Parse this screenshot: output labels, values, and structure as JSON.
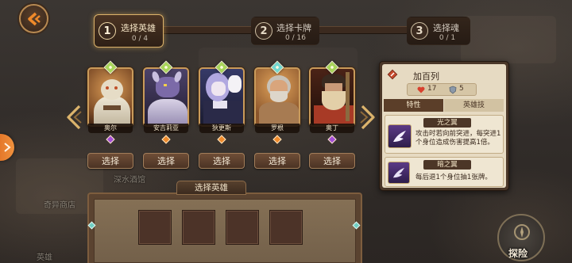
{
  "back_button": {
    "icon": "back-arrow-icon"
  },
  "steps": [
    {
      "number": "1",
      "label": "选择英雄",
      "progress": "0 / 4",
      "active": true
    },
    {
      "number": "2",
      "label": "选择卡牌",
      "progress": "0 / 16",
      "active": false
    },
    {
      "number": "3",
      "label": "选择魂",
      "progress": "0 / 1",
      "active": false
    }
  ],
  "hero_carousel": {
    "prev_icon": "chevron-left-icon",
    "next_icon": "chevron-right-icon"
  },
  "heroes": [
    {
      "name": "奥尔",
      "select_label": "选择",
      "rank_color": "#a8d65a",
      "tier_color": "#a44fd6"
    },
    {
      "name": "安吉莉亚",
      "select_label": "选择",
      "rank_color": "#a8d65a",
      "tier_color": "#ee8a2c"
    },
    {
      "name": "狄更斯",
      "select_label": "选择",
      "rank_color": "#a8d65a",
      "tier_color": "#ee8a2c"
    },
    {
      "name": "罗根",
      "select_label": "选择",
      "rank_color": "#72d8d0",
      "tier_color": "#ee8a2c"
    },
    {
      "name": "奥丁",
      "select_label": "选择",
      "rank_color": "#a8d65a",
      "tier_color": "#a44fd6"
    }
  ],
  "hero_detail": {
    "name": "加百列",
    "stats": [
      {
        "icon": "heart-icon",
        "value": "17"
      },
      {
        "icon": "shield-icon",
        "value": "5"
      }
    ],
    "tabs": [
      {
        "label": "特性",
        "active": true
      },
      {
        "label": "英雄技",
        "active": false
      }
    ],
    "traits": [
      {
        "title": "光之翼",
        "description": "攻击时若向前突进，每突进1个身位造成伤害提高1倍。",
        "icon": "light-wing-icon"
      },
      {
        "title": "暗之翼",
        "description": "每后退1个身位抽1张牌。",
        "icon": "dark-wing-icon"
      }
    ]
  },
  "selection_tray": {
    "title": "选择英雄"
  },
  "background": {
    "tavern_label": "深水酒馆",
    "shop_label": "奇异商店",
    "heroes_label": "英雄",
    "explore_label": "探险"
  },
  "side_tab": {
    "icon": "chevron-right-icon"
  },
  "colors": {
    "accent_gold": "#d9b06a",
    "panel_parchment": "#e6dac2",
    "side_tab_orange": "#e5782a"
  }
}
